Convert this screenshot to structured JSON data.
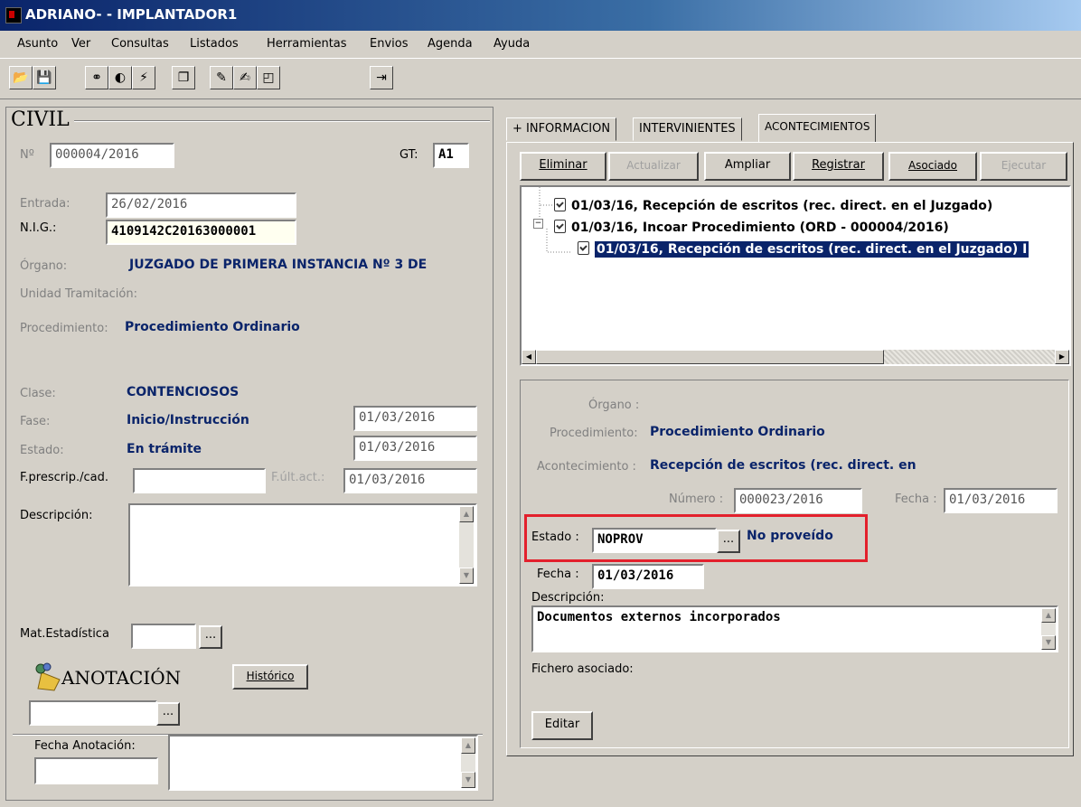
{
  "window": {
    "title": "ADRIANO- - IMPLANTADOR1"
  },
  "menu": [
    "Asunto",
    "Ver",
    "Consultas",
    "Listados",
    "Herramientas",
    "Envios",
    "Agenda",
    "Ayuda"
  ],
  "toolbar_icons": [
    "open-folder-icon",
    "save-icon",
    "binoculars-icon",
    "view-icon",
    "lightning-icon",
    "copy-icon",
    "edit-icon",
    "wand-icon",
    "frame-icon",
    "exit-icon"
  ],
  "left": {
    "section_title": "CIVIL",
    "numero_label": "Nº",
    "numero": "000004/2016",
    "gt_label": "GT:",
    "gt": "A1",
    "entrada_label": "Entrada:",
    "entrada": "26/02/2016",
    "nig_label": "N.I.G.:",
    "nig": "4109142C20163000001",
    "organo_label": "Órgano:",
    "organo": "JUZGADO DE PRIMERA INSTANCIA Nº 3 DE",
    "unidad_label": "Unidad Tramitación:",
    "procedimiento_label": "Procedimiento:",
    "procedimiento": "Procedimiento Ordinario",
    "clase_label": "Clase:",
    "clase": "CONTENCIOSOS",
    "fase_label": "Fase:",
    "fase": "Inicio/Instrucción",
    "fase_fecha": "01/03/2016",
    "estado_label": "Estado:",
    "estado": "En trámite",
    "estado_fecha": "01/03/2016",
    "fprescrip_label": "F.prescrip./cad.",
    "fultact_label": "F.últ.act.:",
    "fultact": "01/03/2016",
    "descripcion_label": "Descripción:",
    "matestad_label": "Mat.Estadística",
    "dots": "...",
    "anotacion_title": "ANOTACIÓN",
    "historico_button": "Histórico",
    "fecha_anotacion_label": "Fecha Anotación:"
  },
  "tabs": [
    "+ INFORMACION",
    "INTERVINIENTES",
    "ACONTECIMIENTOS"
  ],
  "actions": [
    "Eliminar",
    "Actualizar",
    "Ampliar",
    "Registrar",
    "Asociado",
    "Ejecutar"
  ],
  "tree": [
    "01/03/16, Recepción de escritos (rec. direct. en el Juzgado)",
    "01/03/16, Incoar Procedimiento (ORD - 000004/2016)",
    "01/03/16, Recepción de escritos (rec. direct. en el Juzgado) I"
  ],
  "detail": {
    "organo_label": "Órgano :",
    "procedimiento_label": "Procedimiento:",
    "procedimiento": "Procedimiento Ordinario",
    "acontecimiento_label": "Acontecimiento :",
    "acontecimiento": "Recepción de escritos (rec. direct. en",
    "numero_label": "Número :",
    "numero": "000023/2016",
    "fecha_label": "Fecha :",
    "fecha": "01/03/2016",
    "estado_label": "Estado :",
    "estado_code": "NOPROV",
    "estado_desc": "No proveído",
    "fecha2_label": "Fecha :",
    "fecha2": "01/03/2016",
    "descripcion_label": "Descripción:",
    "descripcion": "Documentos externos incorporados",
    "fichero_label": "Fichero asociado:",
    "editar_button": "Editar"
  },
  "colors": {
    "highlight_box": "#e3202c",
    "value_blue": "#0a246a",
    "titlebar": "#0a246a"
  }
}
